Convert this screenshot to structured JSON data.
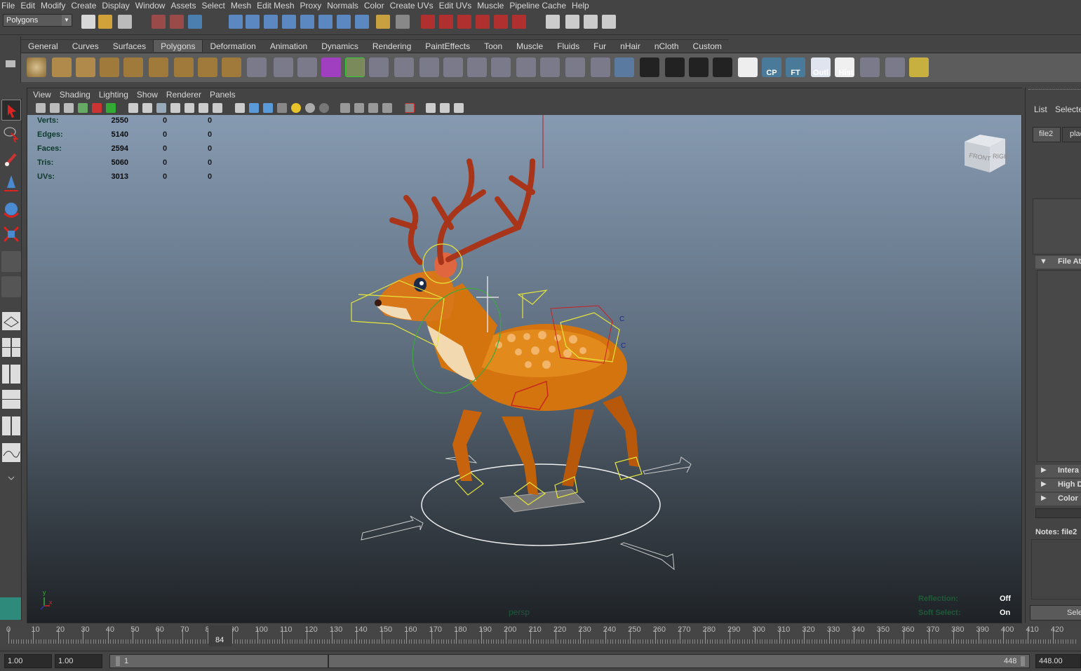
{
  "menubar": [
    "File",
    "Edit",
    "Modify",
    "Create",
    "Display",
    "Window",
    "Assets",
    "Select",
    "Mesh",
    "Edit Mesh",
    "Proxy",
    "Normals",
    "Color",
    "Create UVs",
    "Edit UVs",
    "Muscle",
    "Pipeline Cache",
    "Help"
  ],
  "status": {
    "mode": "Polygons"
  },
  "shelf": {
    "tabs": [
      "General",
      "Curves",
      "Surfaces",
      "Polygons",
      "Deformation",
      "Animation",
      "Dynamics",
      "Rendering",
      "PaintEffects",
      "Toon",
      "Muscle",
      "Fluids",
      "Fur",
      "nHair",
      "nCloth",
      "Custom"
    ],
    "active_tab": "Polygons",
    "text_buttons": [
      "CP",
      "FT",
      "Outl",
      "Hist"
    ]
  },
  "panel": {
    "menu": [
      "View",
      "Shading",
      "Lighting",
      "Show",
      "Renderer",
      "Panels"
    ],
    "camera": "persp",
    "hud": [
      {
        "label": "Verts:",
        "v1": "2550",
        "v2": "0",
        "v3": "0"
      },
      {
        "label": "Edges:",
        "v1": "5140",
        "v2": "0",
        "v3": "0"
      },
      {
        "label": "Faces:",
        "v1": "2594",
        "v2": "0",
        "v3": "0"
      },
      {
        "label": "Tris:",
        "v1": "5060",
        "v2": "0",
        "v3": "0"
      },
      {
        "label": "UVs:",
        "v1": "3013",
        "v2": "0",
        "v3": "0"
      }
    ],
    "hud2": [
      {
        "label": "Reflection:",
        "value": "Off"
      },
      {
        "label": "Soft Select:",
        "value": "On"
      }
    ],
    "viewcube": {
      "front": "FRONT",
      "right": "RIGHT"
    },
    "axes": {
      "y": "y",
      "x": "x"
    }
  },
  "attr_editor": {
    "tabs": [
      "List",
      "Selected"
    ],
    "node_tabs": [
      "file2",
      "plac"
    ],
    "sections": [
      "File At",
      "Intera",
      "High D",
      "Color"
    ],
    "notes_label": "Notes: file2",
    "select_button": "Selec"
  },
  "timeline": {
    "ticks": [
      "0",
      "10",
      "20",
      "30",
      "40",
      "50",
      "60",
      "70",
      "80",
      "90",
      "100",
      "110",
      "120",
      "130",
      "140",
      "150",
      "160",
      "170",
      "180",
      "190",
      "200",
      "210",
      "220",
      "230",
      "240",
      "250",
      "260",
      "270",
      "280",
      "290",
      "300",
      "310",
      "320",
      "330",
      "340",
      "350",
      "360",
      "370",
      "380",
      "390",
      "400",
      "410",
      "420"
    ],
    "current_frame": "84"
  },
  "range": {
    "start": "1.00",
    "playback_start": "1.00",
    "slider_start": "1",
    "slider_end": "448",
    "end": "448.00"
  },
  "colors": {
    "viewport_top": "#869ab1",
    "viewport_bottom": "#1e2226",
    "shelf_bg": "#5c5c5c",
    "ui_bg": "#444444"
  }
}
